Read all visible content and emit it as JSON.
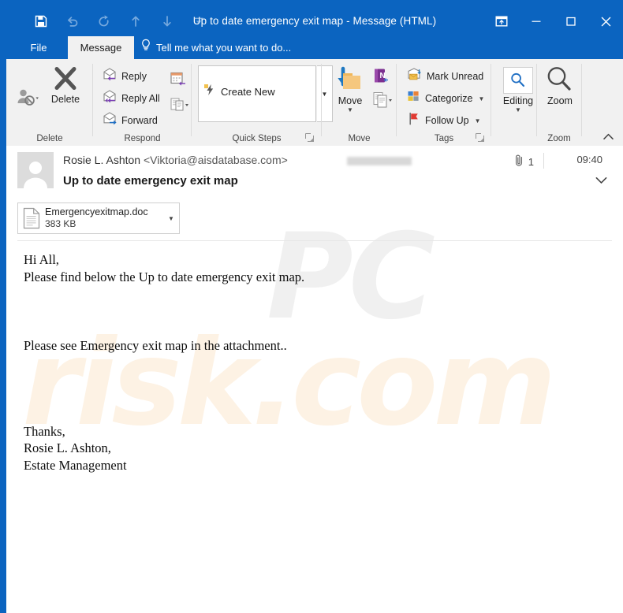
{
  "window": {
    "title": "Up to date emergency exit map - Message (HTML)",
    "accent_color": "#0b64c0",
    "controls": {
      "ribbon_display": "ribbon-display-options",
      "minimize": "minimize",
      "maximize": "maximize",
      "close": "close"
    }
  },
  "quick_access": {
    "items": [
      {
        "name": "save",
        "label": "Save"
      },
      {
        "name": "undo",
        "label": "Undo"
      },
      {
        "name": "redo",
        "label": "Redo"
      },
      {
        "name": "previous-item",
        "label": "Previous Item"
      },
      {
        "name": "next-item",
        "label": "Next Item"
      },
      {
        "name": "customize",
        "label": "Customize Quick Access Toolbar"
      }
    ]
  },
  "tabs": {
    "file": "File",
    "message": "Message",
    "tell_me": "Tell me what you want to do...",
    "active": "Message"
  },
  "ribbon": {
    "groups": [
      {
        "name": "delete",
        "label": "Delete",
        "buttons": [
          {
            "name": "ignore",
            "label": ""
          },
          {
            "name": "delete",
            "label": "Delete"
          }
        ]
      },
      {
        "name": "respond",
        "label": "Respond",
        "buttons": [
          {
            "name": "reply",
            "label": "Reply"
          },
          {
            "name": "reply-all",
            "label": "Reply All"
          },
          {
            "name": "forward",
            "label": "Forward"
          },
          {
            "name": "meeting",
            "label": ""
          },
          {
            "name": "more-respond",
            "label": ""
          }
        ]
      },
      {
        "name": "quick-steps",
        "label": "Quick Steps",
        "buttons": [
          {
            "name": "create-new",
            "label": "Create New"
          },
          {
            "name": "quick-steps-more",
            "label": ""
          }
        ]
      },
      {
        "name": "move",
        "label": "Move",
        "buttons": [
          {
            "name": "move",
            "label": "Move"
          },
          {
            "name": "onenote",
            "label": ""
          },
          {
            "name": "rules",
            "label": ""
          }
        ]
      },
      {
        "name": "tags",
        "label": "Tags",
        "buttons": [
          {
            "name": "mark-unread",
            "label": "Mark Unread"
          },
          {
            "name": "categorize",
            "label": "Categorize"
          },
          {
            "name": "follow-up",
            "label": "Follow Up"
          }
        ]
      },
      {
        "name": "zoom",
        "label": "Zoom",
        "buttons": [
          {
            "name": "editing",
            "label": "Editing"
          },
          {
            "name": "zoom",
            "label": "Zoom"
          }
        ]
      }
    ],
    "collapse_label": "Collapse the Ribbon"
  },
  "message": {
    "sender_name": "Rosie L. Ashton",
    "sender_email": "<Viktoria@aisdatabase.com>",
    "subject": "Up to date emergency exit map",
    "attachment_count": "1",
    "time": "09:40",
    "recipient": "",
    "attachment": {
      "filename": "Emergencyexitmap.doc",
      "size": "383 KB"
    },
    "body": "Hi All,\nPlease find below the Up to date emergency exit map.\n\n\n\nPlease see Emergency exit map in the attachment..\n\n\n\n\nThanks,\nRosie L. Ashton,\nEstate Management"
  },
  "watermark": {
    "part1": "PC",
    "part2": "risk.com",
    "color1": "#f0f0f0",
    "color2": "#fdf2e4"
  }
}
